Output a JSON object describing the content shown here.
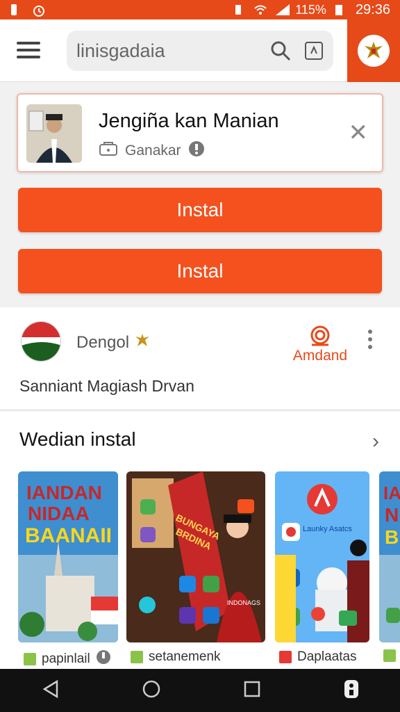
{
  "status": {
    "battery": "115%",
    "time": "29:36"
  },
  "search": {
    "text": "linisgadaia"
  },
  "card": {
    "title": "Jengiña kan Manian",
    "subtitle": "Ganakar"
  },
  "buttons": {
    "primary": "Instal",
    "secondary": "Instal"
  },
  "developer": {
    "name": "Dengol",
    "action": "Amdand",
    "description": "Sanniant Magiash Drvan"
  },
  "section": {
    "title": "Wedian instal",
    "items": [
      {
        "poster": [
          "IANDAN",
          "NIDAA",
          "BAANAII"
        ],
        "label": "papinlail"
      },
      {
        "poster": [
          "BUNGAYA",
          "BRDINA",
          "INDONAGS"
        ],
        "label": "setanemenk"
      },
      {
        "poster": [
          "Launky Asatcs"
        ],
        "label": "Daplaatas"
      },
      {
        "poster": [
          "IA",
          "N",
          "B"
        ],
        "label": ""
      }
    ]
  },
  "colors": {
    "accent": "#f4511e",
    "statusbar": "#e64a19"
  }
}
